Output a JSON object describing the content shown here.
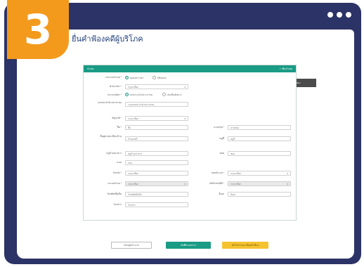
{
  "step_badge": "3",
  "window_dots": [
    "dot",
    "dot",
    "dot"
  ],
  "page_title": "ยื่นคำฟ้องคดีผู้บริโภค",
  "wizard": {
    "steps": [
      "1. โจทก์",
      "2. จำเลย",
      "3. รายละเอียดคำฟ้องและข้อเท็จจริง",
      "4. เอกสารหลักฐานที่เกี่ยวข้อง",
      "5. ยืนยันและตรวจสอบ"
    ],
    "active_index": 1
  },
  "panel": {
    "title": "จำเลย",
    "add_label": "+ เพิ่มจำเลย"
  },
  "form": {
    "defendant_type_label": "ประเภทจำเลย *",
    "defendant_type_options": [
      "บุคคลธรรมดา",
      "นิติบุคคล"
    ],
    "prefix_label": "คำนำหน้า *",
    "prefix_value": "กรุณาเลือก",
    "id_type_label": "ประเภทบัตร *",
    "id_type_options": [
      "เลขประจำตัวประชาชน",
      "หนังสือเดินทาง"
    ],
    "id_number_label": "เลขประจำตัวประชาชน",
    "id_number_value": "ระบุเลขประจำตัวประชาชน",
    "nationality_label": "สัญชาติ *",
    "nationality_value": "กรุณาเลือก",
    "first_name_label": "ชื่อ *",
    "first_name_value": "ชื่อ",
    "last_name_label": "นามสกุล *",
    "last_name_value": "นามสกุล",
    "address_no_label": "ที่อยู่ตามทะเบียนบ้าน",
    "address_no_value": "บ้านเลขที่",
    "moo_label": "หมู่ที่",
    "moo_value": "หมู่ที่",
    "village_label": "หมู่บ้าน/อาคาร",
    "village_value": "หมู่บ้าน/อาคาร",
    "soi_label": "ซอย",
    "soi_value": "ซอย",
    "road_label": "ถนน",
    "road_value": "ถนน",
    "province_label": "จังหวัด *",
    "province_value": "กรุณาเลือก",
    "district_label": "เขต/อำเภอ *",
    "district_value": "กรุณาเลือก",
    "subdistrict_label": "แขวง/ตำบล *",
    "subdistrict_value": "กรุณาเลือก",
    "postcode_label": "รหัสไปรษณีย์ *",
    "postcode_value": "กรุณาเลือก",
    "phone_label": "โทรศัพท์มือถือ",
    "phone_value": "โทรศัพท์มือถือ",
    "email_label": "อีเมล",
    "email_value": "อีเมล",
    "fax_label": "โทรสาร",
    "fax_value": "โทรสาร"
  },
  "buttons": {
    "back": "กลับสู่หน้าแรก",
    "save": "บันทึกแบบร่าง",
    "next": "ถัดไป/รายละเอียดคำฟ้อง"
  }
}
